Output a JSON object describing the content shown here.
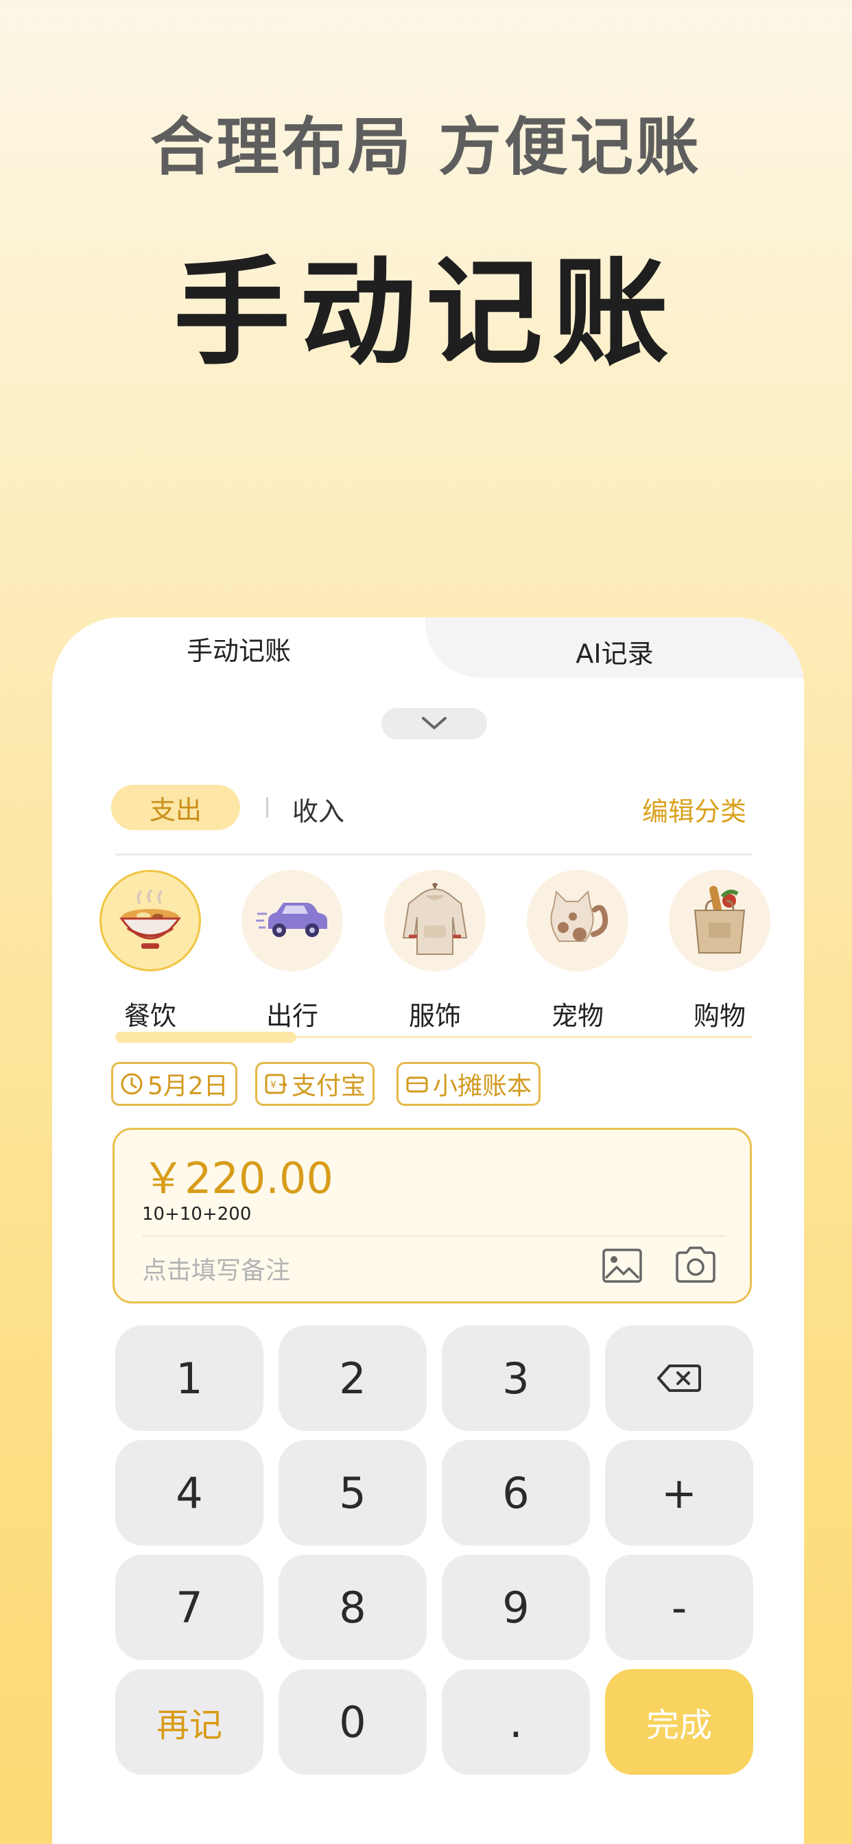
{
  "hero": {
    "subtitle": "合理布局 方便记账",
    "title": "手动记账"
  },
  "tabs": {
    "manual": "手动记账",
    "ai": "AI记录"
  },
  "type_switch": {
    "expense": "支出",
    "income": "收入",
    "edit_category": "编辑分类"
  },
  "categories": [
    {
      "label": "餐饮",
      "icon": "noodle-bowl-icon",
      "selected": true
    },
    {
      "label": "出行",
      "icon": "car-icon"
    },
    {
      "label": "服饰",
      "icon": "hoodie-icon"
    },
    {
      "label": "宠物",
      "icon": "cat-icon"
    },
    {
      "label": "购物",
      "icon": "grocery-bag-icon"
    }
  ],
  "chips": {
    "date": "5月2日",
    "payment": "支付宝",
    "ledger": "小摊账本"
  },
  "amount": {
    "value": "￥220.00",
    "formula": "10+10+200",
    "note_placeholder": "点击填写备注"
  },
  "keypad": {
    "k1": "1",
    "k2": "2",
    "k3": "3",
    "k4": "4",
    "k5": "5",
    "k6": "6",
    "k_plus": "+",
    "k7": "7",
    "k8": "8",
    "k9": "9",
    "k_minus": "-",
    "again": "再记",
    "k0": "0",
    "k_dot": ".",
    "done": "完成"
  },
  "colors": {
    "accent": "#d89c19",
    "accent_fill": "#f8d35f",
    "accent_light": "#fde6a6",
    "key_bg": "#ececee"
  }
}
